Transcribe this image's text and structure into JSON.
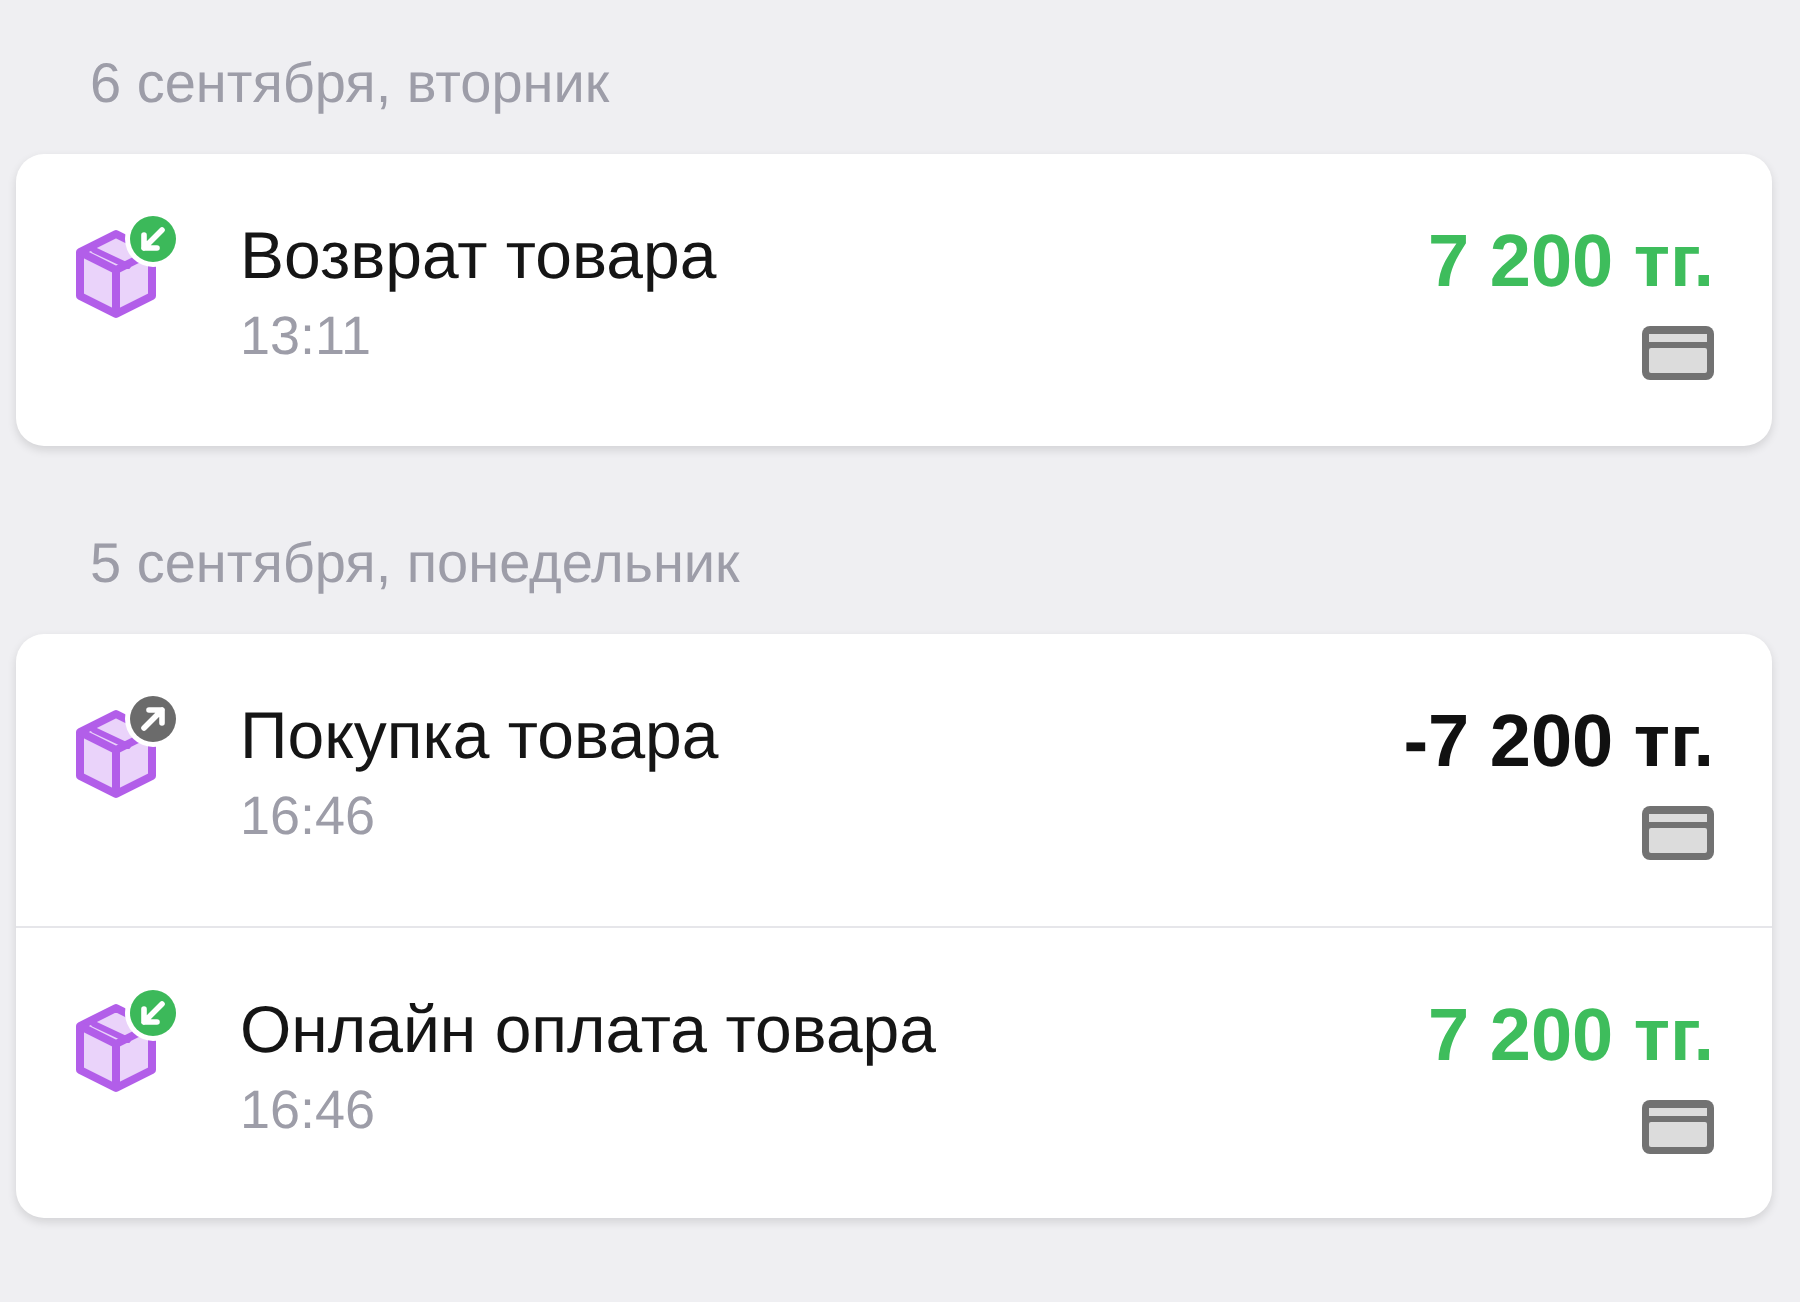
{
  "sections": [
    {
      "date": "6 сентября, вторник",
      "operations": [
        {
          "kind": "incoming",
          "title": "Возврат товара",
          "time": "13:11",
          "amount": "7 200 тг."
        }
      ]
    },
    {
      "date": "5 сентября, понедельник",
      "operations": [
        {
          "kind": "outgoing",
          "title": "Покупка товара",
          "time": "16:46",
          "amount": "-7 200 тг."
        },
        {
          "kind": "incoming",
          "title": "Онлайн оплата товара",
          "time": "16:46",
          "amount": "7 200 тг."
        }
      ]
    }
  ]
}
